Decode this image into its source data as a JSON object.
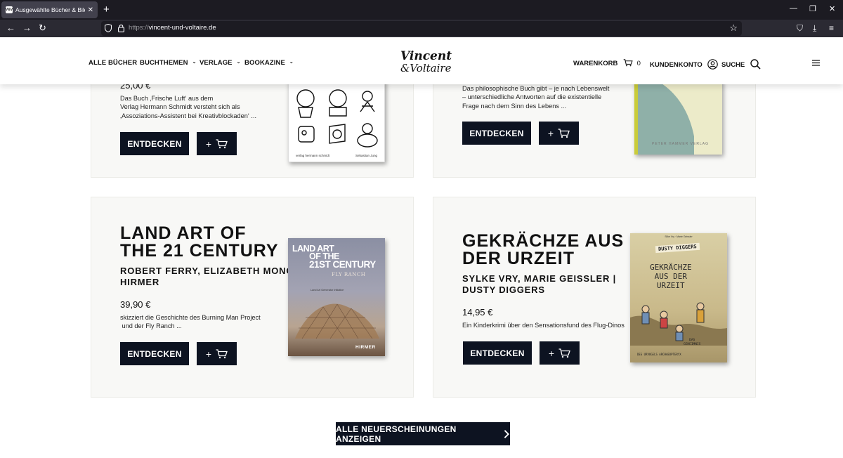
{
  "browser": {
    "tab_title": "Ausgewählte Bücher & Bildbä",
    "url_prefix": "https://",
    "url_host": "vincent-und-voltaire.de"
  },
  "header": {
    "nav": [
      "ALLE BÜCHER",
      "BUCHTHEMEN",
      "VERLAGE",
      "BOOKAZINE"
    ],
    "logo_line1": "Vincent",
    "logo_line2": "&Voltaire",
    "cart_label": "WARENKORB",
    "cart_count": "0",
    "account_label": "KUNDENKONTO",
    "search_label": "SUCHE"
  },
  "cards": [
    {
      "price": "25,00 €",
      "desc": [
        "Das Buch ‚Frische Luft‘ aus dem",
        "Verlag Hermann Schmidt versteht sich als",
        "‚Assoziations-Assistent bei Kreativblockaden‘ ..."
      ],
      "button": "ENTDECKEN",
      "cover_publisher": "verlag hermann schmidt",
      "cover_author": "Sebastian Jung"
    },
    {
      "desc": [
        "Das philosophische Buch gibt – je nach Lebenswelt",
        "– unterschiedliche Antworten auf die existentielle",
        "Frage nach dem Sinn des Lebens ..."
      ],
      "button": "ENTDECKEN",
      "cover_publisher": "PETER HAMMER VERLAG"
    },
    {
      "title": [
        "LAND ART OF",
        "THE 21 CENTURY"
      ],
      "author": [
        "ROBERT FERRY, ELIZABETH MONOIAN |",
        "HIRMER"
      ],
      "price": "39,90 €",
      "desc": [
        "skizziert die Geschichte des Burning Man Project",
        " und der Fly Ranch ..."
      ],
      "button": "ENTDECKEN",
      "cover_title": [
        "LAND ART",
        "OF THE",
        "21ST CENTURY"
      ],
      "cover_sub": "FLY RANCH",
      "cover_small": "Land Art Generator Initiative",
      "cover_publisher": "HIRMER"
    },
    {
      "title": [
        "GEKRÄCHZE AUS",
        "DER URZEIT"
      ],
      "author": [
        "SYLKE VRY, MARIE GEISSLER |",
        "DUSTY DIGGERS"
      ],
      "price": "14,95 €",
      "desc": [
        "Ein Kinderkrimi über den Sensationsfund des Flug-Dinos"
      ],
      "button": "ENTDECKEN",
      "cover_top": "Silke Vry · Marie Geissler",
      "cover_series": "DUSTY DIGGERS",
      "cover_title": [
        "GEKRÄCHZE",
        "AUS DER",
        "URZEIT"
      ],
      "cover_bottom": [
        "DAS",
        "GEHEIMNIS",
        "DES URVOGELS ARCHAEOPTERYX"
      ]
    }
  ],
  "all_button": "ALLE NEUERSCHEINUNGEN ANZEIGEN"
}
